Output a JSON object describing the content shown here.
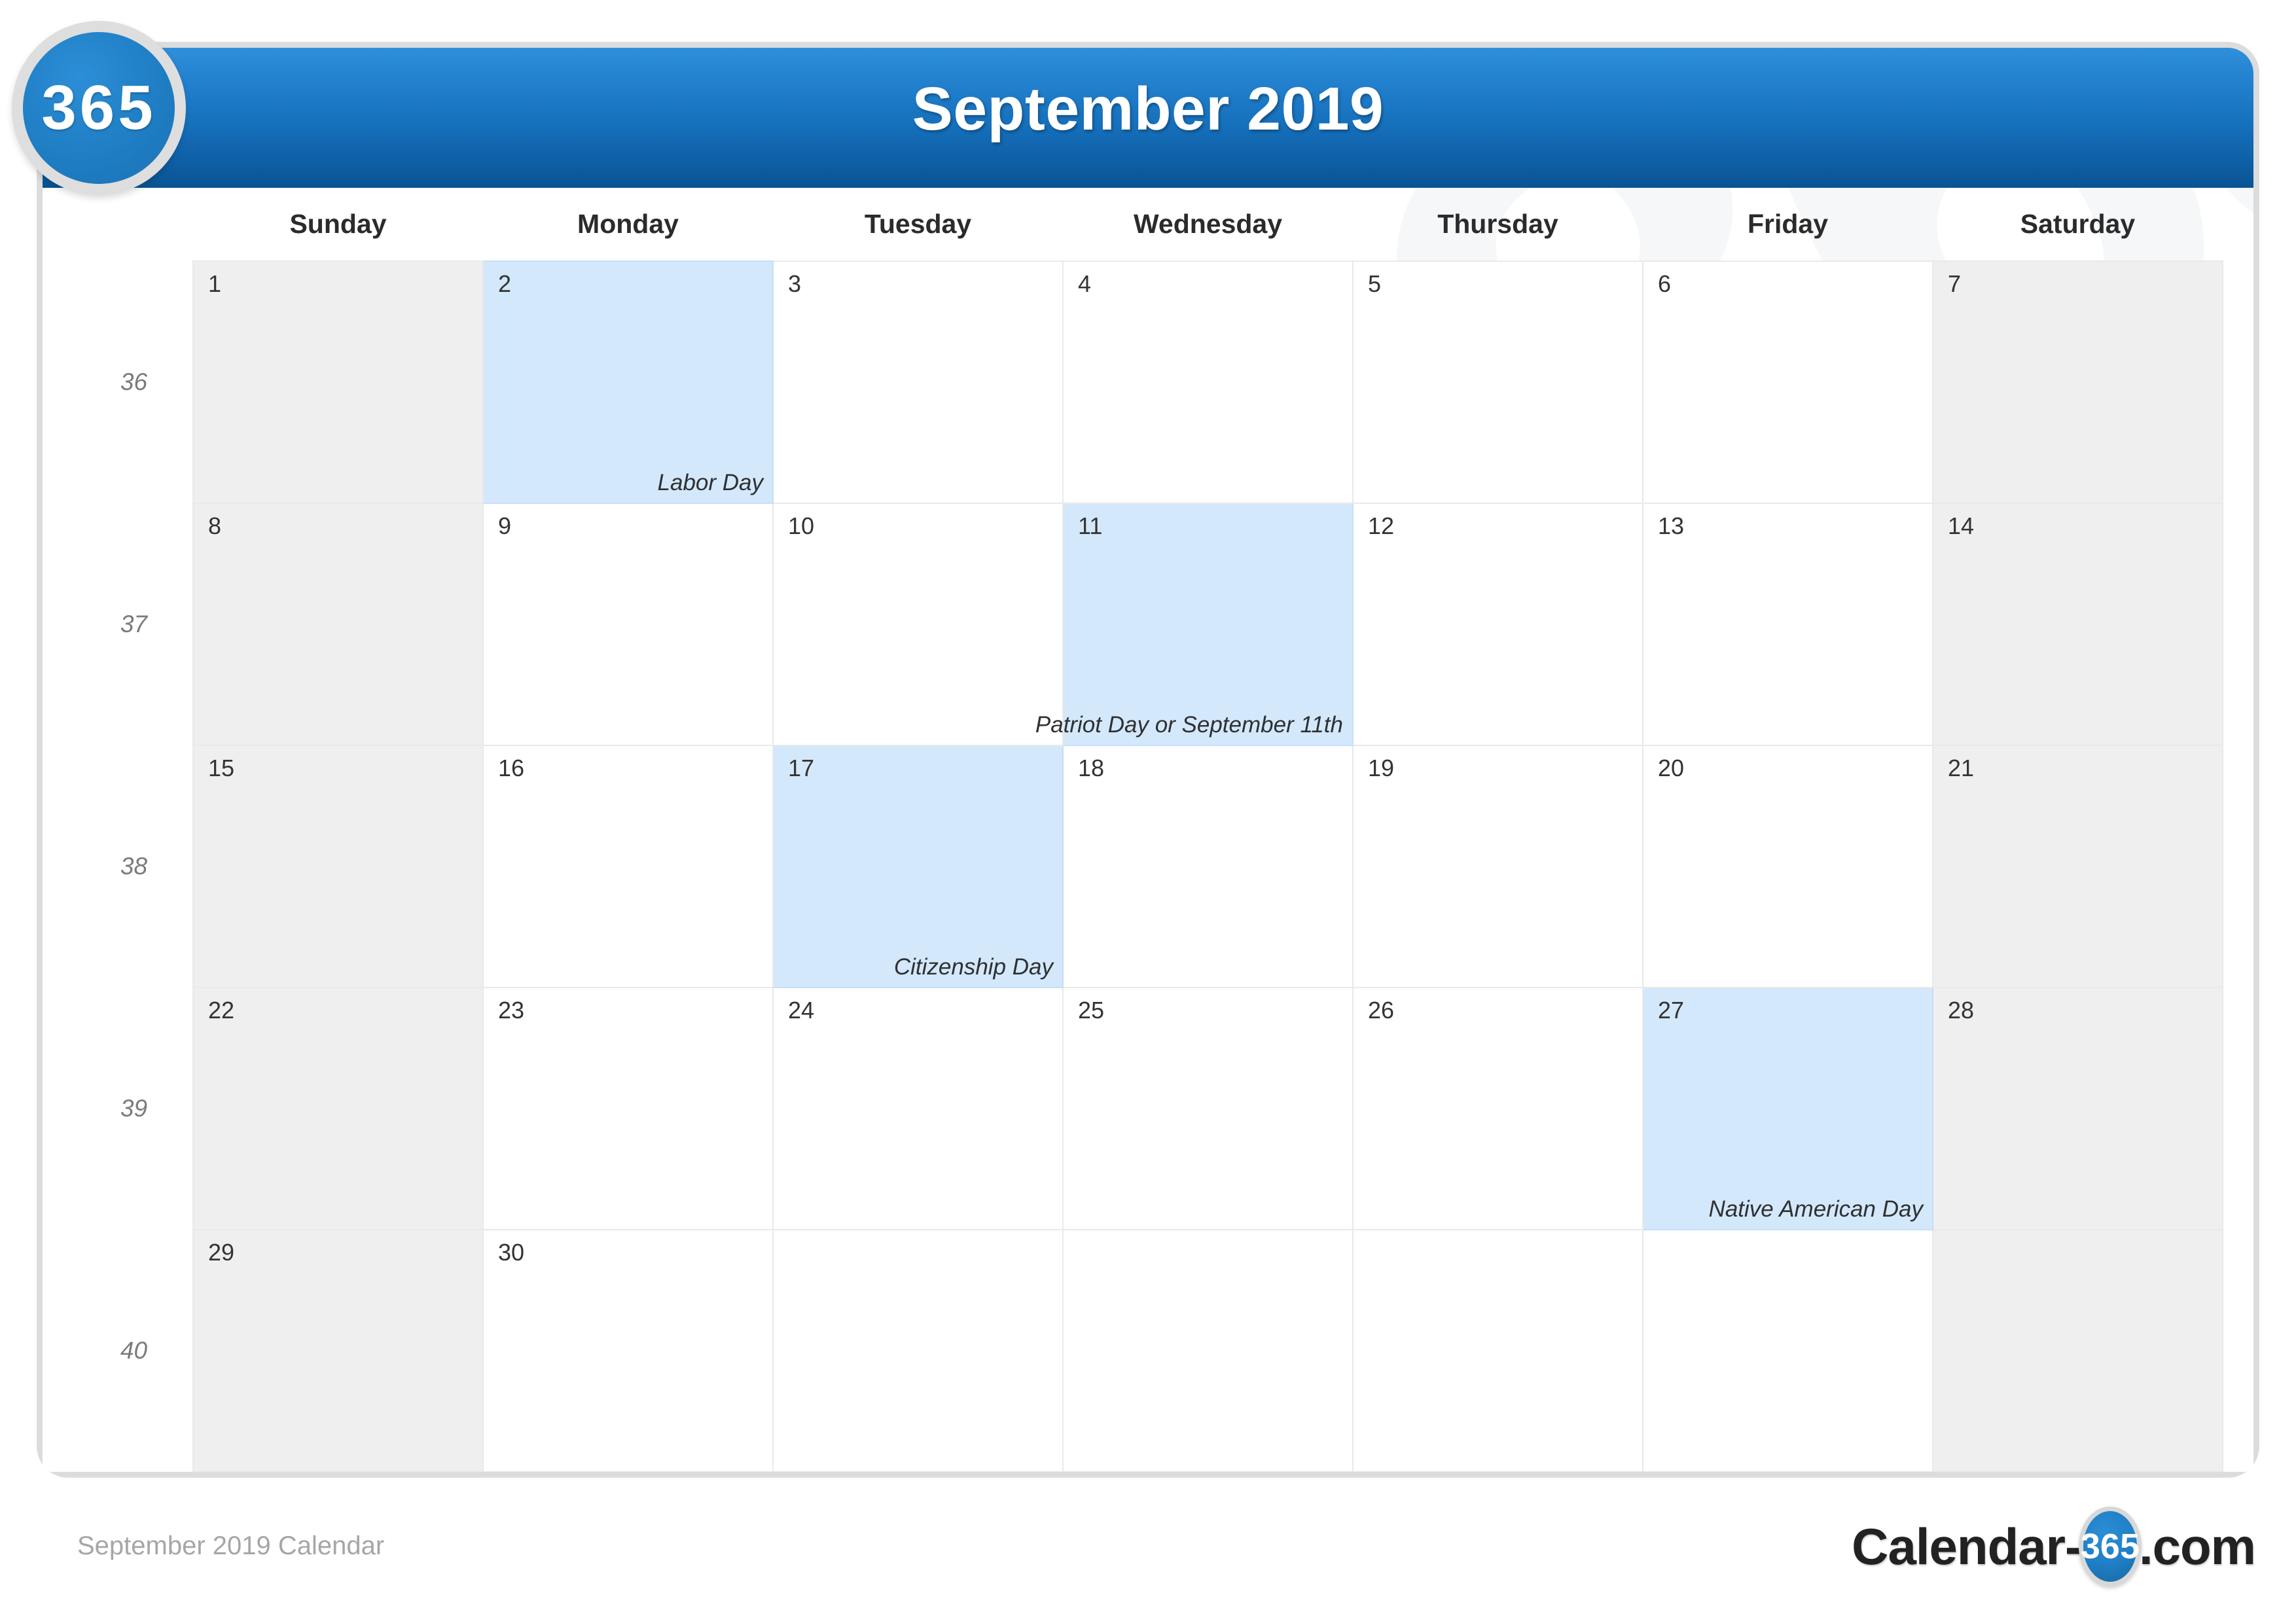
{
  "brand": {
    "badge_text": "365",
    "accent_blue": "#1f7ec4",
    "header_gradient_top": "#2f90da",
    "header_gradient_bottom": "#0a5392",
    "holiday_cell_color": "#d4e8fb",
    "weekend_cell_color": "#efefef"
  },
  "header": {
    "title": "September 2019"
  },
  "calendar": {
    "week_column_header": "",
    "weekdays": [
      "Sunday",
      "Monday",
      "Tuesday",
      "Wednesday",
      "Thursday",
      "Friday",
      "Saturday"
    ],
    "weeks": [
      {
        "week_number": "36",
        "days": [
          {
            "num": "1",
            "holiday": "",
            "weekend": true,
            "highlight": false
          },
          {
            "num": "2",
            "holiday": "Labor Day",
            "weekend": false,
            "highlight": true
          },
          {
            "num": "3",
            "holiday": "",
            "weekend": false,
            "highlight": false
          },
          {
            "num": "4",
            "holiday": "",
            "weekend": false,
            "highlight": false
          },
          {
            "num": "5",
            "holiday": "",
            "weekend": false,
            "highlight": false
          },
          {
            "num": "6",
            "holiday": "",
            "weekend": false,
            "highlight": false
          },
          {
            "num": "7",
            "holiday": "",
            "weekend": true,
            "highlight": false
          }
        ]
      },
      {
        "week_number": "37",
        "days": [
          {
            "num": "8",
            "holiday": "",
            "weekend": true,
            "highlight": false
          },
          {
            "num": "9",
            "holiday": "",
            "weekend": false,
            "highlight": false
          },
          {
            "num": "10",
            "holiday": "",
            "weekend": false,
            "highlight": false
          },
          {
            "num": "11",
            "holiday": "Patriot Day or September 11th",
            "weekend": false,
            "highlight": true
          },
          {
            "num": "12",
            "holiday": "",
            "weekend": false,
            "highlight": false
          },
          {
            "num": "13",
            "holiday": "",
            "weekend": false,
            "highlight": false
          },
          {
            "num": "14",
            "holiday": "",
            "weekend": true,
            "highlight": false
          }
        ]
      },
      {
        "week_number": "38",
        "days": [
          {
            "num": "15",
            "holiday": "",
            "weekend": true,
            "highlight": false
          },
          {
            "num": "16",
            "holiday": "",
            "weekend": false,
            "highlight": false
          },
          {
            "num": "17",
            "holiday": "Citizenship Day",
            "weekend": false,
            "highlight": true
          },
          {
            "num": "18",
            "holiday": "",
            "weekend": false,
            "highlight": false
          },
          {
            "num": "19",
            "holiday": "",
            "weekend": false,
            "highlight": false
          },
          {
            "num": "20",
            "holiday": "",
            "weekend": false,
            "highlight": false
          },
          {
            "num": "21",
            "holiday": "",
            "weekend": true,
            "highlight": false
          }
        ]
      },
      {
        "week_number": "39",
        "days": [
          {
            "num": "22",
            "holiday": "",
            "weekend": true,
            "highlight": false
          },
          {
            "num": "23",
            "holiday": "",
            "weekend": false,
            "highlight": false
          },
          {
            "num": "24",
            "holiday": "",
            "weekend": false,
            "highlight": false
          },
          {
            "num": "25",
            "holiday": "",
            "weekend": false,
            "highlight": false
          },
          {
            "num": "26",
            "holiday": "",
            "weekend": false,
            "highlight": false
          },
          {
            "num": "27",
            "holiday": "Native American Day",
            "weekend": false,
            "highlight": true
          },
          {
            "num": "28",
            "holiday": "",
            "weekend": true,
            "highlight": false
          }
        ]
      },
      {
        "week_number": "40",
        "days": [
          {
            "num": "29",
            "holiday": "",
            "weekend": true,
            "highlight": false
          },
          {
            "num": "30",
            "holiday": "",
            "weekend": false,
            "highlight": false
          },
          {
            "num": "",
            "holiday": "",
            "weekend": false,
            "highlight": false
          },
          {
            "num": "",
            "holiday": "",
            "weekend": false,
            "highlight": false
          },
          {
            "num": "",
            "holiday": "",
            "weekend": false,
            "highlight": false
          },
          {
            "num": "",
            "holiday": "",
            "weekend": false,
            "highlight": false
          },
          {
            "num": "",
            "holiday": "",
            "weekend": true,
            "highlight": false
          }
        ]
      }
    ]
  },
  "watermark": {
    "text": "365"
  },
  "footer": {
    "caption": "September 2019 Calendar",
    "logo_prefix": "Calendar-",
    "logo_badge": "365",
    "logo_suffix": ".com"
  }
}
